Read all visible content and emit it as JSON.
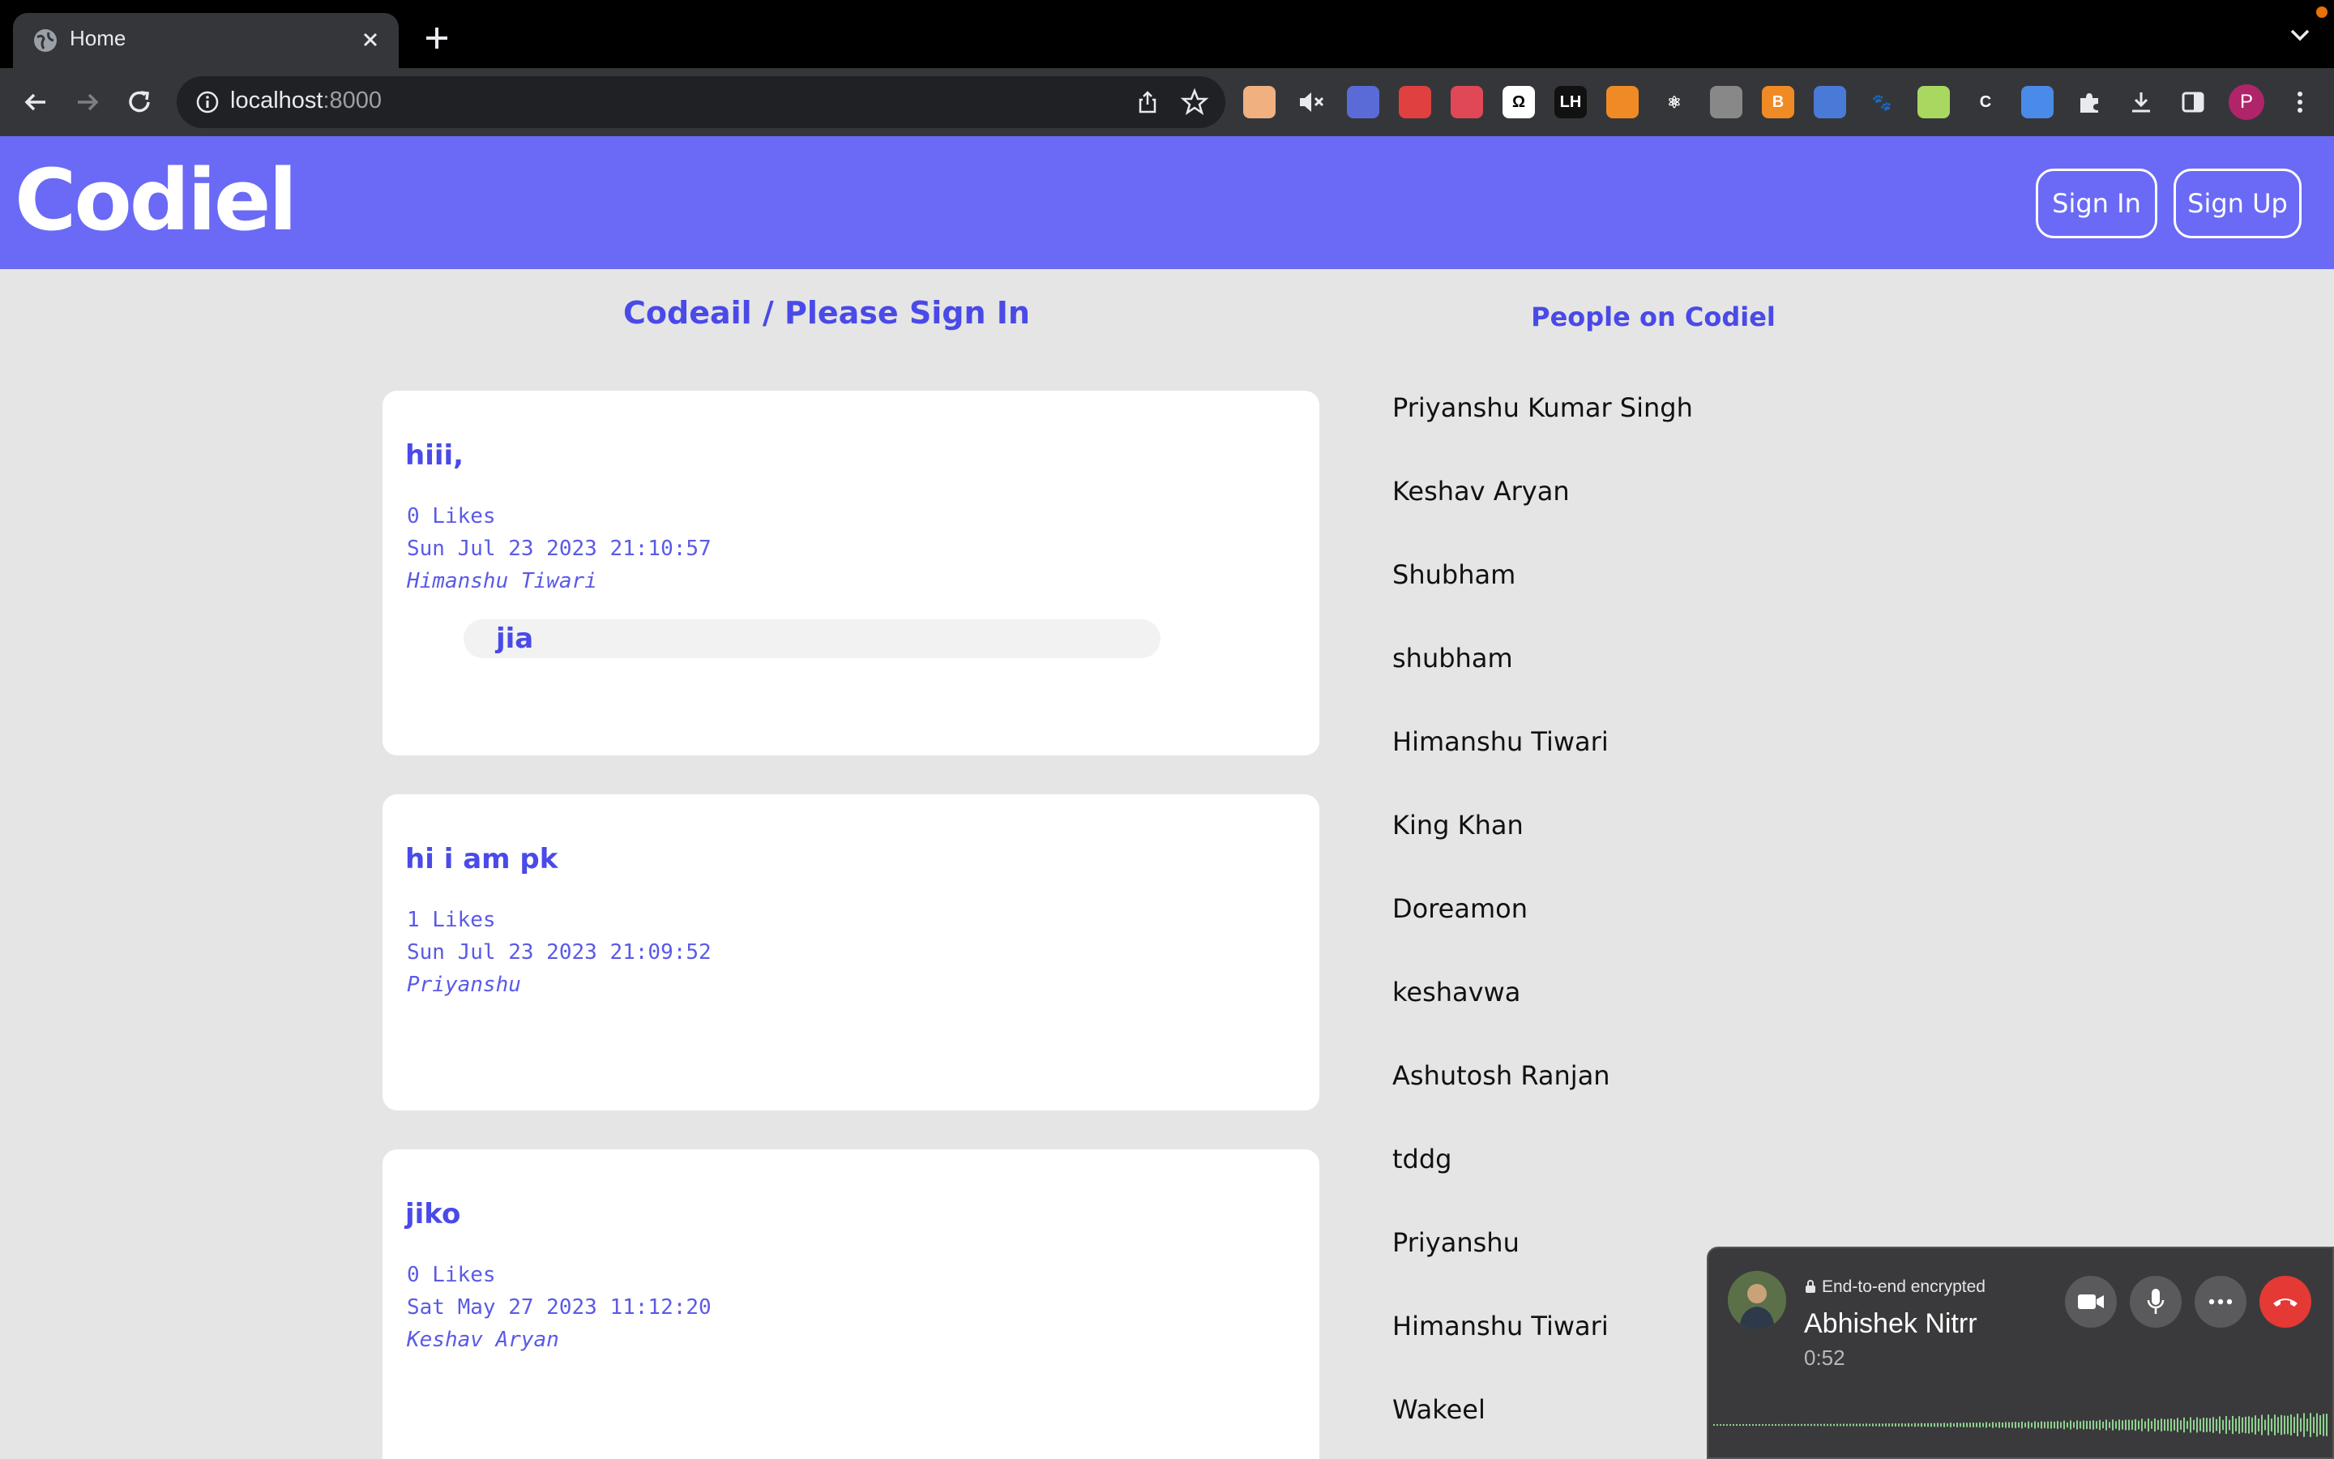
{
  "browser": {
    "tab_title": "Home",
    "url_host": "localhost",
    "url_port": ":8000",
    "profile_initial": "P",
    "extensions": [
      {
        "name": "pill-extension-icon",
        "color": "#f0b080",
        "label": ""
      },
      {
        "name": "mute-icon",
        "color": "#35363a",
        "label": ""
      },
      {
        "name": "shield-extension-icon",
        "color": "#5a6bd8",
        "label": ""
      },
      {
        "name": "red-extension-icon",
        "color": "#e04040",
        "label": ""
      },
      {
        "name": "puzzle-red-extension-icon",
        "color": "#e04858",
        "label": ""
      },
      {
        "name": "omega-extension-icon",
        "color": "#ffffff",
        "label": "Ω"
      },
      {
        "name": "lh-extension-icon",
        "color": "#111111",
        "label": "LH"
      },
      {
        "name": "orange-extension-icon",
        "color": "#f08a24",
        "label": ""
      },
      {
        "name": "react-extension-icon",
        "color": "#35363a",
        "label": "⚛"
      },
      {
        "name": "gray-extension-icon",
        "color": "#888888",
        "label": ""
      },
      {
        "name": "b-extension-icon",
        "color": "#f08a24",
        "label": "B"
      },
      {
        "name": "screen-extension-icon",
        "color": "#4a7ad8",
        "label": ""
      },
      {
        "name": "paw-extension-icon",
        "color": "#35363a",
        "label": "🐾"
      },
      {
        "name": "green-extension-icon",
        "color": "#a8d860",
        "label": ""
      },
      {
        "name": "c-extension-icon",
        "color": "#35363a",
        "label": "C"
      },
      {
        "name": "chat-extension-icon",
        "color": "#4a8ae8",
        "label": ""
      },
      {
        "name": "puzzle-icon",
        "color": "#35363a",
        "label": ""
      },
      {
        "name": "download-icon",
        "color": "#35363a",
        "label": ""
      },
      {
        "name": "sidepanel-icon",
        "color": "#35363a",
        "label": ""
      }
    ]
  },
  "header": {
    "logo": "Codiel",
    "signin_label": "Sign In",
    "signup_label": "Sign Up"
  },
  "main": {
    "title": "Codeail / Please Sign In",
    "posts": [
      {
        "title": "hiii,",
        "likes": "0 Likes",
        "date": "Sun Jul 23 2023 21:10:57",
        "author": "Himanshu Tiwari",
        "comment": "jia"
      },
      {
        "title": "hi i am pk",
        "likes": "1 Likes",
        "date": "Sun Jul 23 2023 21:09:52",
        "author": "Priyanshu"
      },
      {
        "title": "jiko",
        "likes": "0 Likes",
        "date": "Sat May 27 2023 11:12:20",
        "author": "Keshav Aryan"
      }
    ]
  },
  "people": {
    "title": "People on Codiel",
    "list": [
      "Priyanshu Kumar Singh",
      "Keshav Aryan",
      "Shubham",
      "shubham",
      "Himanshu Tiwari",
      "King Khan",
      "Doreamon",
      "keshavwa",
      "Ashutosh Ranjan",
      "tddg",
      "Priyanshu",
      "Himanshu Tiwari",
      "Wakeel"
    ]
  },
  "call": {
    "encryption": "End-to-end encrypted",
    "caller": "Abhishek Nitrr",
    "duration": "0:52"
  }
}
